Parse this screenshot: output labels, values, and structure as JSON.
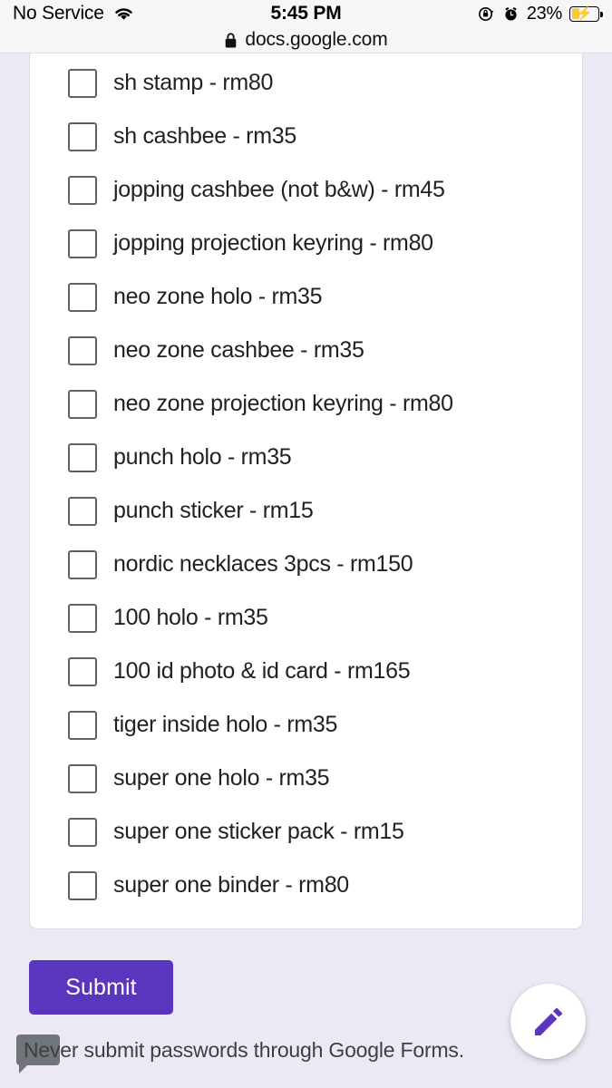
{
  "status_bar": {
    "carrier": "No Service",
    "wifi_icon": "wifi-icon",
    "time": "5:45 PM",
    "rotation_lock_icon": "rotation-lock-icon",
    "alarm_icon": "alarm-clock-icon",
    "battery_percent": "23%",
    "battery_icon": "battery-charging-icon"
  },
  "browser": {
    "lock_icon": "lock-icon",
    "url": "docs.google.com"
  },
  "form": {
    "options": [
      {
        "label": "sh stamp - rm80",
        "checked": false
      },
      {
        "label": "sh cashbee - rm35",
        "checked": false
      },
      {
        "label": "jopping cashbee (not b&w) - rm45",
        "checked": false
      },
      {
        "label": "jopping projection keyring - rm80",
        "checked": false
      },
      {
        "label": "neo zone holo - rm35",
        "checked": false
      },
      {
        "label": "neo zone cashbee - rm35",
        "checked": false
      },
      {
        "label": "neo zone projection keyring - rm80",
        "checked": false
      },
      {
        "label": "punch holo - rm35",
        "checked": false
      },
      {
        "label": "punch sticker - rm15",
        "checked": false
      },
      {
        "label": "nordic necklaces 3pcs - rm150",
        "checked": false
      },
      {
        "label": "100 holo - rm35",
        "checked": false
      },
      {
        "label": "100 id photo & id card - rm165",
        "checked": false
      },
      {
        "label": "tiger inside holo - rm35",
        "checked": false
      },
      {
        "label": "super one holo - rm35",
        "checked": false
      },
      {
        "label": "super one sticker pack - rm15",
        "checked": false
      },
      {
        "label": "super one binder - rm80",
        "checked": false
      }
    ],
    "submit_label": "Submit",
    "footer_note": "Never submit passwords through Google Forms.",
    "edit_fab_icon": "pencil-edit-icon"
  },
  "colors": {
    "accent_purple": "#5a35bd",
    "page_background": "#ece9f4",
    "card_background": "#ffffff",
    "checkbox_border": "#5f6368",
    "battery_charge": "#f7ca3e"
  }
}
